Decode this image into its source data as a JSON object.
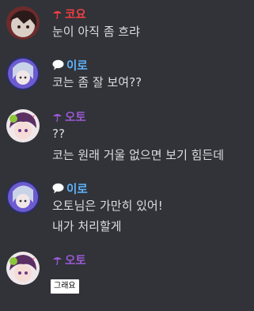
{
  "colors": {
    "background": "#313338",
    "text": "#dbdee1",
    "koyo_name": "#f23f43",
    "iro_name": "#5fb4ff",
    "oto_name": "#9b59d6"
  },
  "messages": [
    {
      "author": "코요",
      "badge_icon": "umbrella-icon",
      "lines": [
        "눈이 아직 좀 흐랴"
      ]
    },
    {
      "author": "이로",
      "badge_icon": "speech-bubble-icon",
      "lines": [
        "코는 좀 잘 보여??"
      ]
    },
    {
      "author": "오토",
      "badge_icon": "umbrella-icon",
      "lines": [
        "??",
        "코는 원래 거울 없으면 보기 힘든데"
      ]
    },
    {
      "author": "이로",
      "badge_icon": "speech-bubble-icon",
      "lines": [
        "오토님은 가만히 있어!",
        "내가 처리할게"
      ]
    },
    {
      "author": "오토",
      "badge_icon": "umbrella-icon",
      "sticker": "그래요"
    }
  ]
}
